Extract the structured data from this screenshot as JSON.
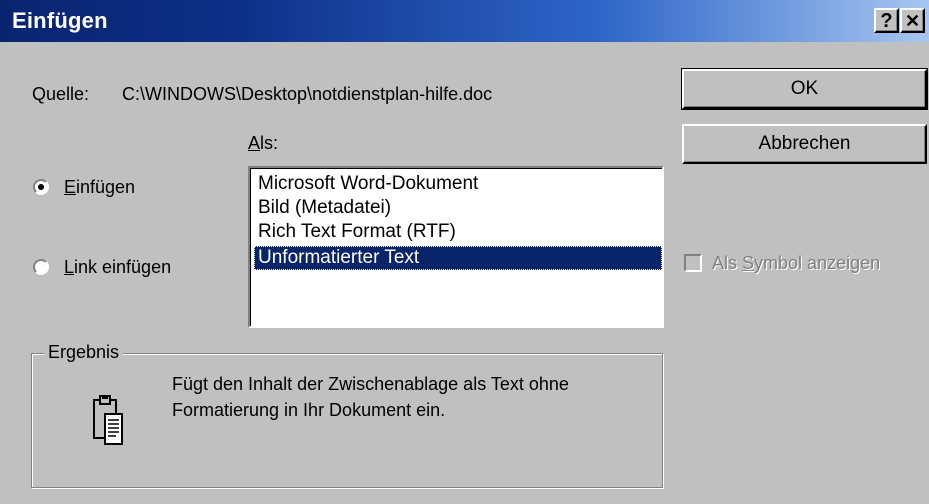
{
  "window": {
    "title": "Einfügen",
    "help_button": "?",
    "close_button": "✕"
  },
  "source": {
    "label": "Quelle:",
    "path": "C:\\WINDOWS\\Desktop\\notdienstplan-hilfe.doc"
  },
  "buttons": {
    "ok": "OK",
    "cancel": "Abbrechen"
  },
  "paste_mode": {
    "selected": "paste",
    "paste_label_accel": "E",
    "paste_label_rest": "infügen",
    "link_label_accel": "L",
    "link_label_rest": "ink einfügen"
  },
  "as_list": {
    "label_accel": "A",
    "label_rest": "ls:",
    "items": [
      "Microsoft Word-Dokument",
      "Bild (Metadatei)",
      "Rich Text Format (RTF)",
      "Unformatierter Text"
    ],
    "selected_index": 3
  },
  "display_as_icon": {
    "prefix": "Als ",
    "accel": "S",
    "rest": "ymbol anzeigen",
    "checked": false,
    "enabled": false
  },
  "result": {
    "title": "Ergebnis",
    "line1": "Fügt den Inhalt der Zwischenablage als Text ohne",
    "line2": "Formatierung in Ihr Dokument ein.",
    "icon": "clipboard-icon"
  },
  "colors": {
    "face": "#c0c0c0",
    "title_start": "#0a2470",
    "title_end": "#a8c6f0",
    "selection": "#0a246a"
  }
}
